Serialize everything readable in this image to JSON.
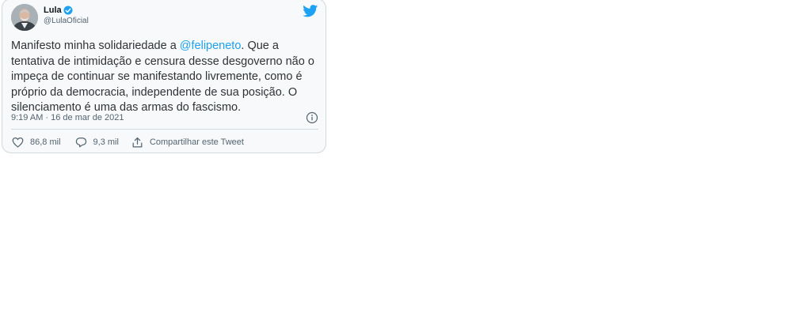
{
  "tweet": {
    "author": {
      "display_name": "Lula",
      "handle": "@LulaOficial",
      "verified": true,
      "avatar_icon": "avatar-photo"
    },
    "text_before_mention": "Manifesto minha solidariedade a ",
    "mention": "@felipeneto",
    "text_after_mention": ". Que a tentativa de intimidação e censura desse desgoverno não o impeça de continuar se manifestando livremente, como é próprio da democracia, independente de sua posição. O silenciamento é uma das armas do fascismo.",
    "timestamp": "9:19 AM · 16 de mar de 2021",
    "actions": {
      "likes": "86,8 mil",
      "replies": "9,3 mil",
      "share_label": "Compartilhar este Tweet"
    },
    "icons": {
      "logo": "twitter-bird-icon",
      "verified": "verified-badge-icon",
      "info": "info-icon",
      "like": "heart-icon",
      "reply": "speech-bubble-icon",
      "share": "share-icon"
    },
    "colors": {
      "brand": "#1da1f2",
      "text": "#2f3336",
      "secondary": "#536471",
      "card_bg": "#f7f9fa",
      "border": "#cfd9de"
    }
  }
}
